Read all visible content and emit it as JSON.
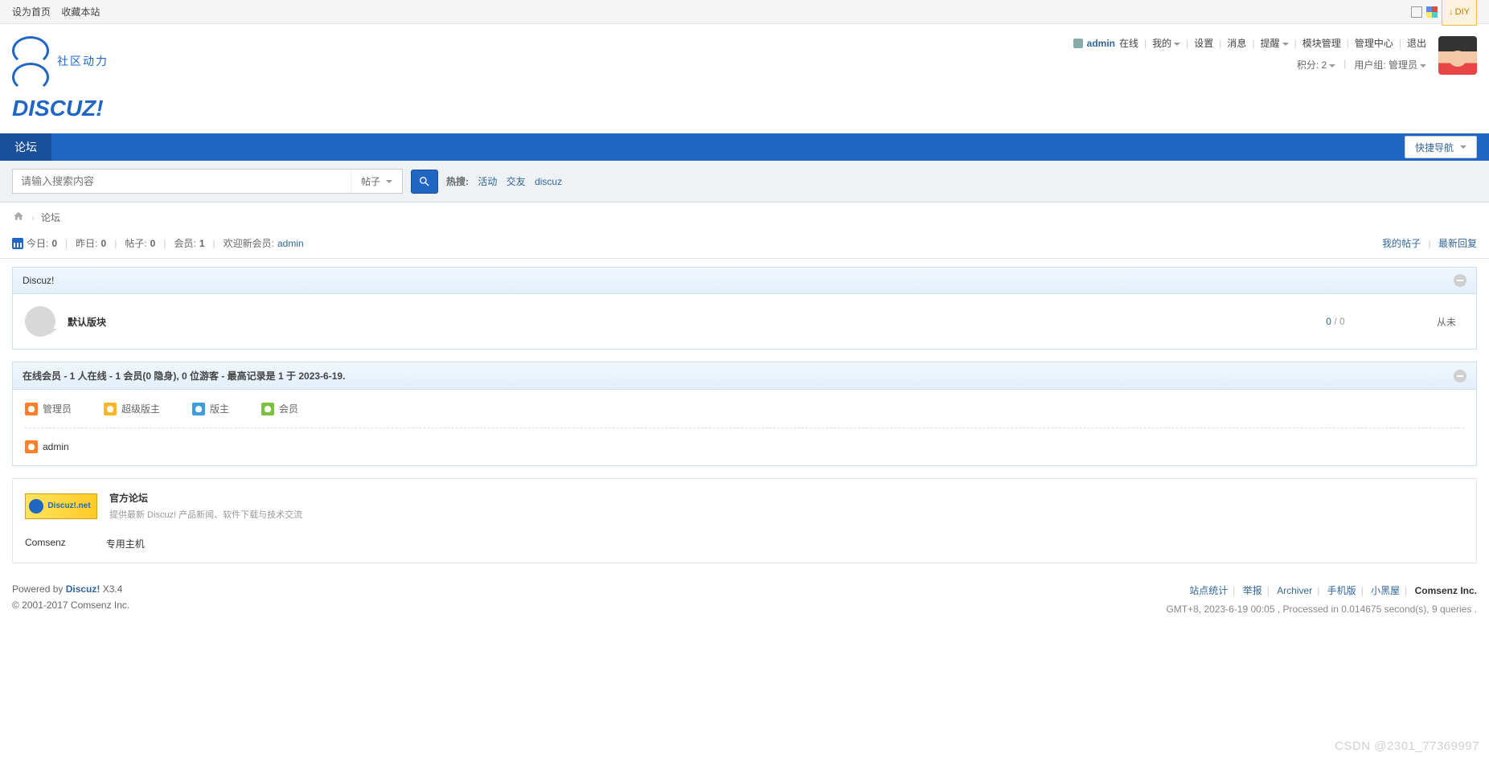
{
  "topbar": {
    "set_home": "设为首页",
    "favorite": "收藏本站",
    "diy": "DIY"
  },
  "header": {
    "logo_subtitle": "社区动力",
    "logo_brand": "DISCUZ!",
    "username": "admin",
    "online": "在线",
    "links": {
      "my": "我的",
      "settings": "设置",
      "messages": "消息",
      "alerts": "提醒",
      "module_mgmt": "模块管理",
      "admin_center": "管理中心",
      "logout": "退出"
    },
    "points_label": "积分: 2",
    "group_label": "用户组: 管理员"
  },
  "nav": {
    "forum": "论坛",
    "quick_nav": "快捷导航"
  },
  "search": {
    "placeholder": "请输入搜索内容",
    "type": "帖子",
    "hot_label": "热搜:",
    "hot_items": [
      "活动",
      "交友",
      "discuz"
    ]
  },
  "breadcrumb": {
    "current": "论坛"
  },
  "stats": {
    "today_label": "今日:",
    "today_val": "0",
    "yesterday_label": "昨日:",
    "yesterday_val": "0",
    "posts_label": "帖子:",
    "posts_val": "0",
    "members_label": "会员:",
    "members_val": "1",
    "welcome_label": "欢迎新会员:",
    "welcome_user": "admin",
    "my_posts": "我的帖子",
    "latest_reply": "最新回复"
  },
  "category": {
    "title": "Discuz!",
    "forum_name": "默认版块",
    "threads": "0",
    "slash": " / ",
    "replies": "0",
    "last": "从未"
  },
  "online": {
    "header": "在线会员 - 1 人在线 - 1 会员(0 隐身), 0 位游客 - 最高记录是 1 于 2023-6-19.",
    "legend": {
      "admin": "管理员",
      "super": "超级版主",
      "mod": "版主",
      "member": "会员"
    },
    "users": [
      "admin"
    ]
  },
  "links": {
    "official_title": "官方论坛",
    "official_desc": "提供最新 Discuz! 产品新闻、软件下载与技术交流",
    "banner_text": "Discuz!.net",
    "comsenz": "Comsenz",
    "hosting": "专用主机"
  },
  "footer": {
    "powered_by": "Powered by ",
    "product": "Discuz!",
    "version": " X3.4",
    "copyright": "© 2001-2017 Comsenz Inc.",
    "right_links": {
      "stats": "站点统计",
      "report": "举报",
      "archiver": "Archiver",
      "mobile": "手机版",
      "darkroom": "小黑屋",
      "comsenz": "Comsenz Inc."
    },
    "gmt": "GMT+8, 2023-6-19 00:05 , Processed in 0.014675 second(s), 9 queries ."
  },
  "watermark": "CSDN @2301_77369997"
}
